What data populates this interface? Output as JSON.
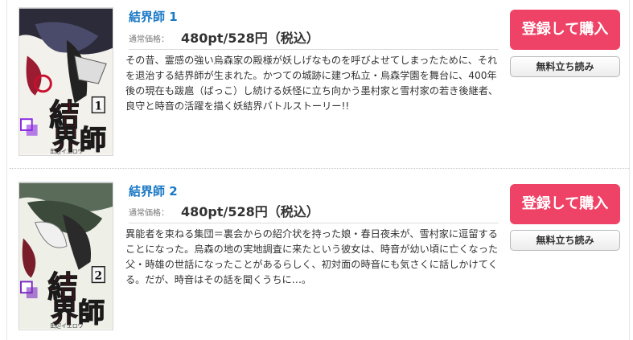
{
  "items": [
    {
      "title": "結界師 1",
      "price_label": "通常価格：",
      "price": "480pt/528円（税込）",
      "description": "その昔、霊感の強い烏森家の殿様が妖しげなものを呼びよせてしまったために、それを退治する結界師が生まれた。かつての城跡に建つ私立・烏森学園を舞台に、400年後の現在も跋扈（ばっこ）し続ける妖怪に立ち向かう墨村家と雪村家の若き後継者、良守と時音の活躍を描く妖結界バトルストーリー!!",
      "buy_label": "登録して購入",
      "read_label": "無料立ち読み",
      "cover": {
        "volume": "1",
        "logo": "結界師",
        "author": "田辺イエロウ",
        "accent": "#c8102e"
      }
    },
    {
      "title": "結界師 2",
      "price_label": "通常価格：",
      "price": "480pt/528円（税込）",
      "description": "異能者を束ねる集団＝裏会からの紹介状を持った娘・春日夜未が、雪村家に逗留することになった。烏森の地の実地調査に来たという彼女は、時音が幼い頃に亡くなった父・時雄の世話になったことがあるらしく、初対面の時音にも気さくに話しかけてくる。だが、時音はその話を聞くうちに…。",
      "buy_label": "登録して購入",
      "read_label": "無料立ち読み",
      "cover": {
        "volume": "2",
        "logo": "結界師",
        "author": "田辺イエロウ",
        "accent": "#c8102e"
      }
    }
  ],
  "colors": {
    "title": "#1a79c6",
    "buy_button": "#ee4266"
  }
}
